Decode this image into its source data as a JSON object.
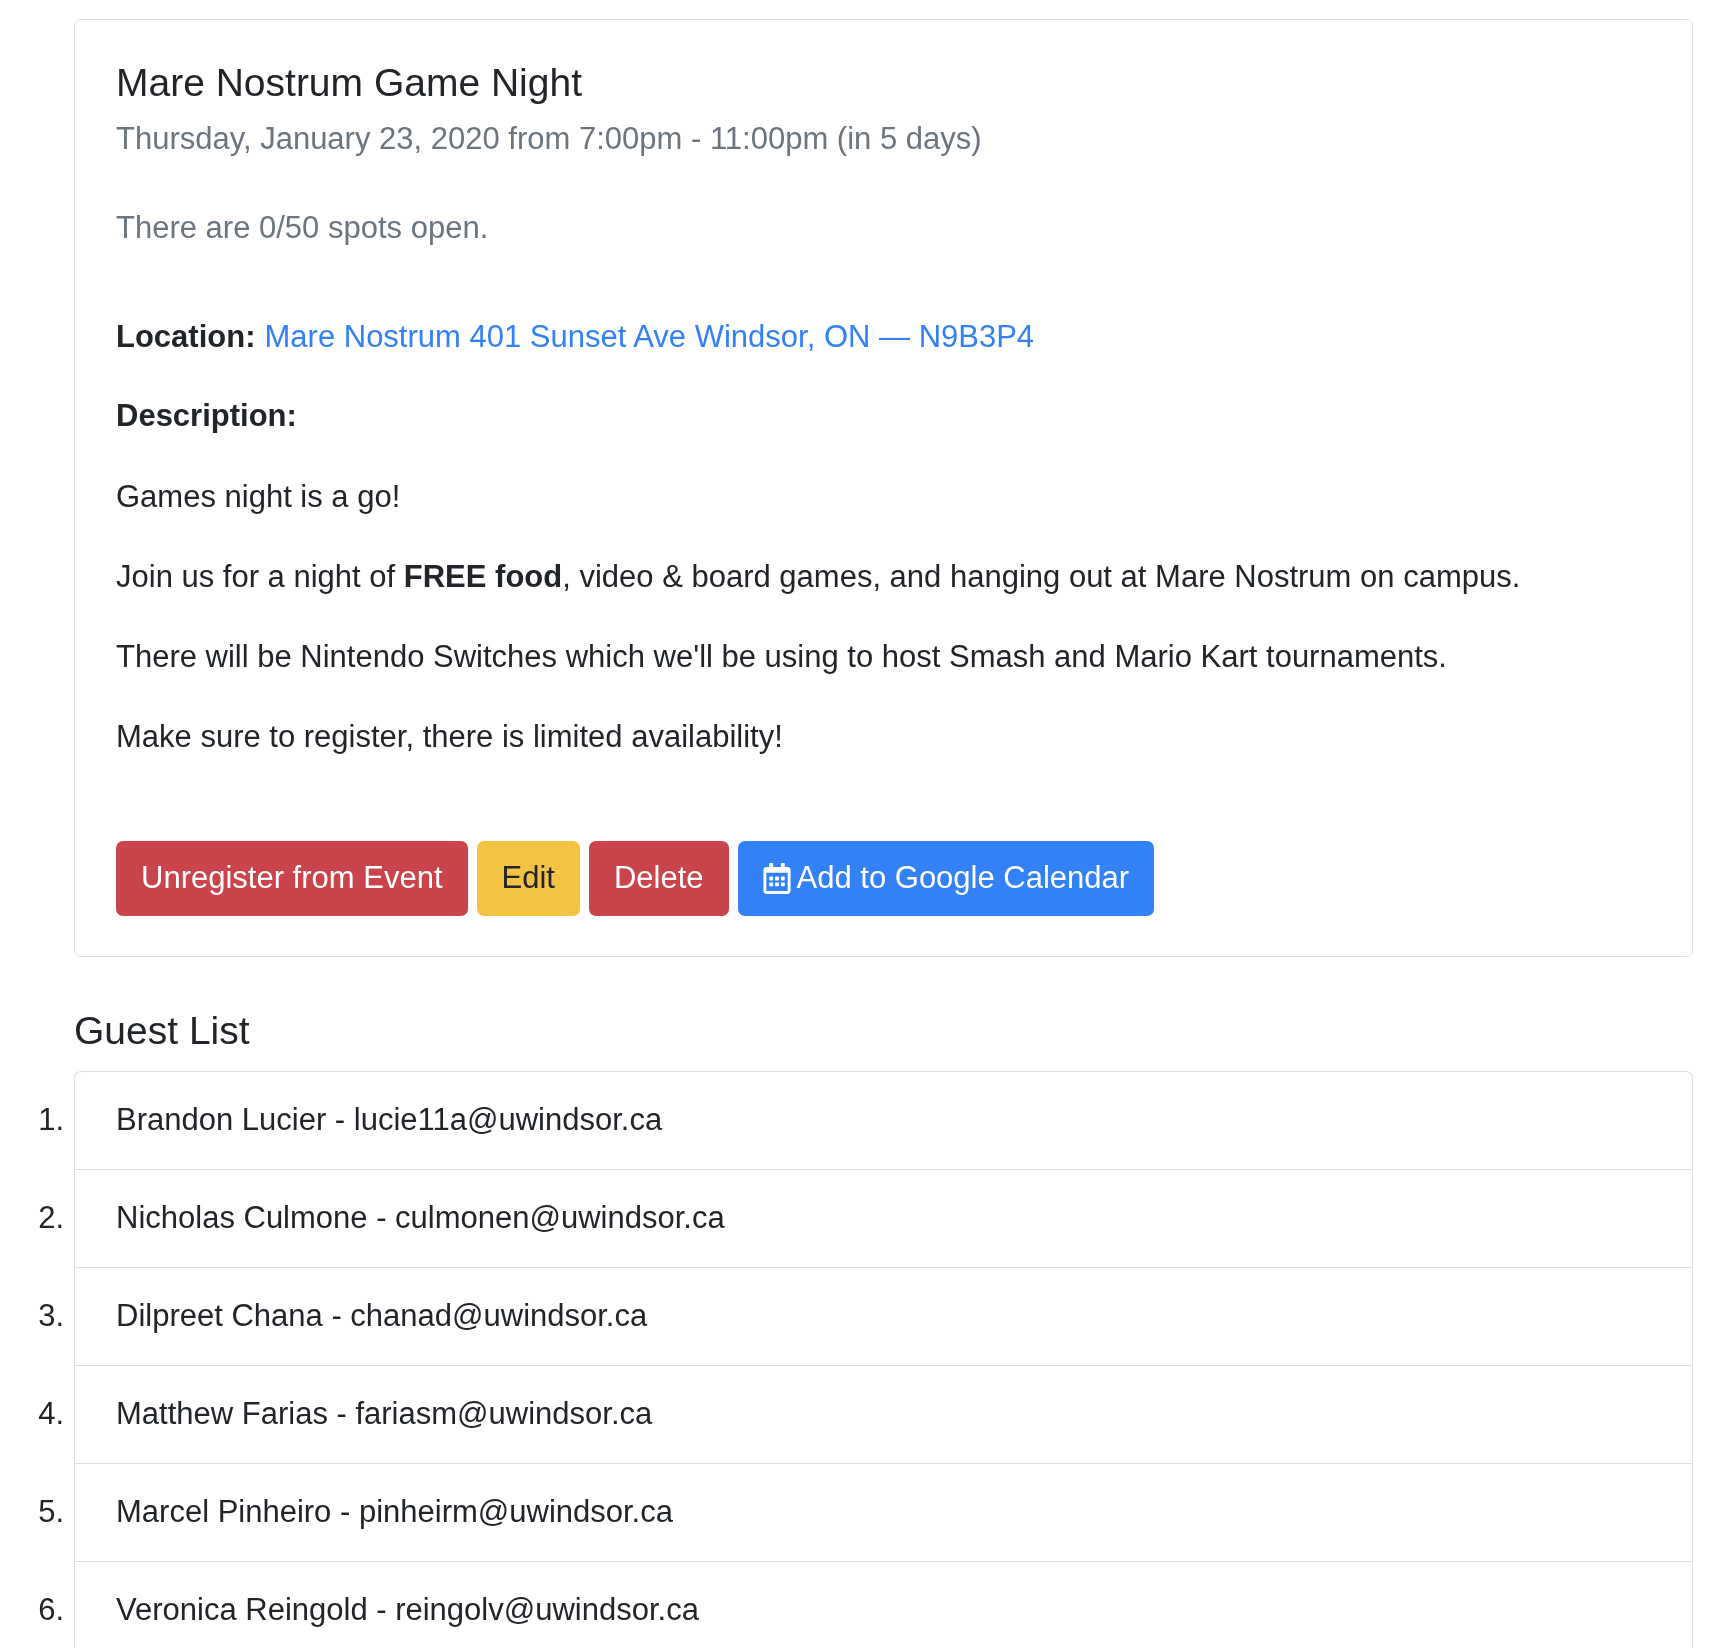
{
  "event": {
    "title": "Mare Nostrum Game Night",
    "datetime": "Thursday, January 23, 2020 from 7:00pm - 11:00pm (in 5 days)",
    "spots": "There are 0/50 spots open.",
    "location": {
      "label": "Location:",
      "value": "Mare Nostrum 401 Sunset Ave Windsor, ON — N9B3P4"
    },
    "description": {
      "label": "Description:",
      "paragraphs": [
        "Games night is a go!",
        "Join us for a night of **FREE food**, video & board games, and hanging out at Mare Nostrum on campus.",
        "There will be Nintendo Switches which we'll be using to host Smash and Mario Kart tournaments.",
        "Make sure to register, there is limited availability!"
      ]
    },
    "buttons": [
      {
        "label": "Unregister from Event",
        "kind": "danger",
        "icon": false
      },
      {
        "label": "Edit",
        "kind": "warning",
        "icon": false
      },
      {
        "label": "Delete",
        "kind": "danger",
        "icon": false
      },
      {
        "label": "Add to Google Calendar",
        "kind": "primary",
        "icon": true
      }
    ]
  },
  "guest_list": {
    "title": "Guest List",
    "guests": [
      {
        "number": "1.",
        "text": "Brandon Lucier - lucie11a@uwindsor.ca"
      },
      {
        "number": "2.",
        "text": "Nicholas Culmone - culmonen@uwindsor.ca"
      },
      {
        "number": "3.",
        "text": "Dilpreet Chana - chanad@uwindsor.ca"
      },
      {
        "number": "4.",
        "text": "Matthew Farias - fariasm@uwindsor.ca"
      },
      {
        "number": "5.",
        "text": "Marcel Pinheiro - pinheirm@uwindsor.ca"
      },
      {
        "number": "6.",
        "text": "Veronica Reingold - reingolv@uwindsor.ca"
      }
    ]
  }
}
